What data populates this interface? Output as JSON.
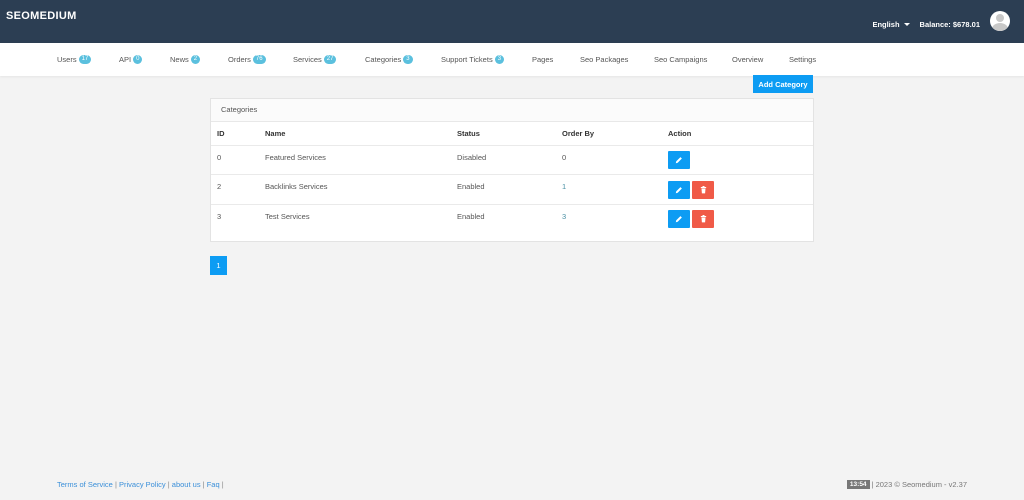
{
  "header": {
    "brand": "SEOMEDIUM",
    "language": "English",
    "balance": "Balance: $678.01"
  },
  "nav": [
    {
      "label": "Users",
      "badge": "17"
    },
    {
      "label": "API",
      "badge": "0"
    },
    {
      "label": "News",
      "badge": "2"
    },
    {
      "label": "Orders",
      "badge": "76"
    },
    {
      "label": "Services",
      "badge": "27"
    },
    {
      "label": "Categories",
      "badge": "3"
    },
    {
      "label": "Support Tickets",
      "badge": "3"
    },
    {
      "label": "Pages",
      "badge": ""
    },
    {
      "label": "Seo Packages",
      "badge": ""
    },
    {
      "label": "Seo Campaigns",
      "badge": ""
    },
    {
      "label": "Overview",
      "badge": ""
    },
    {
      "label": "Settings",
      "badge": ""
    }
  ],
  "actions": {
    "add_category": "Add Category"
  },
  "panel": {
    "title": "Categories",
    "columns": [
      "ID",
      "Name",
      "Status",
      "Order By",
      "Action"
    ],
    "rows": [
      {
        "id": "0",
        "name": "Featured Services",
        "status": "Disabled",
        "order": "0"
      },
      {
        "id": "2",
        "name": "Backlinks Services",
        "status": "Enabled",
        "order": "1"
      },
      {
        "id": "3",
        "name": "Test Services",
        "status": "Enabled",
        "order": "3"
      }
    ]
  },
  "pagination": {
    "current": "1"
  },
  "footer": {
    "links": [
      "Terms of Service",
      "Privacy Policy",
      "about us",
      "Faq"
    ],
    "time": "13:54",
    "copyright": "| 2023 © Seomedium - v2.37"
  },
  "colors": {
    "topbar": "#2c3e53",
    "primary": "#0d9cf3",
    "danger": "#f05a47",
    "badge": "#5bc0de"
  }
}
